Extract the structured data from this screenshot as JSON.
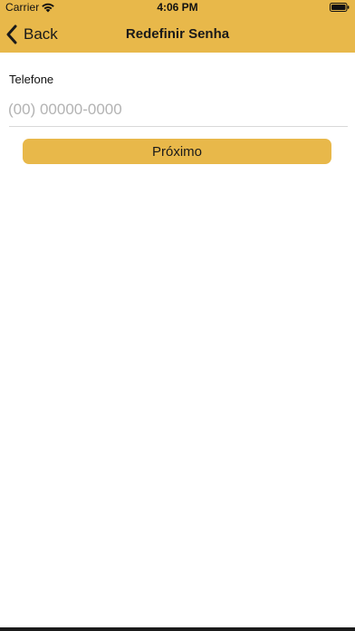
{
  "status_bar": {
    "carrier": "Carrier",
    "time": "4:06 PM"
  },
  "nav": {
    "back_label": "Back",
    "title": "Redefinir Senha"
  },
  "form": {
    "phone_label": "Telefone",
    "phone_value": "",
    "phone_placeholder": "(00) 00000-0000",
    "next_button_label": "Próximo"
  },
  "colors": {
    "accent": "#e8b84a",
    "placeholder": "#b3b3b3"
  }
}
